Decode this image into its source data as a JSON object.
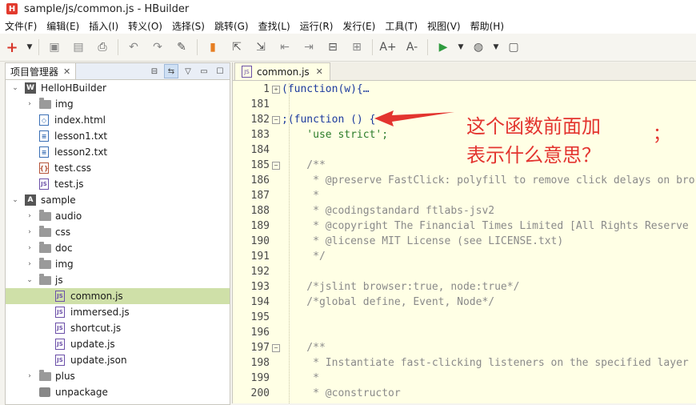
{
  "window": {
    "logo": "H",
    "title": "sample/js/common.js  -  HBuilder"
  },
  "menu": [
    "文件(F)",
    "编辑(E)",
    "插入(I)",
    "转义(O)",
    "选择(S)",
    "跳转(G)",
    "查找(L)",
    "运行(R)",
    "发行(E)",
    "工具(T)",
    "视图(V)",
    "帮助(H)"
  ],
  "toolbar": {
    "icons": [
      "new-icon",
      "save-icon",
      "save-all-icon",
      "print-icon",
      "undo-icon",
      "redo-icon",
      "format-icon",
      "bookmark-icon",
      "import-icon",
      "export-icon",
      "prev-icon",
      "next-icon",
      "comment-icon",
      "uncomment-icon",
      "font-bigger-icon",
      "font-smaller-icon",
      "run-icon",
      "browser-icon",
      "help-icon"
    ],
    "font_big": "A+",
    "font_small": "A-"
  },
  "project_panel": {
    "title": "项目管理器",
    "close": "✕",
    "tree": [
      {
        "level": 0,
        "twisty": "open",
        "icon": "project-w",
        "label": "HelloHBuilder"
      },
      {
        "level": 1,
        "twisty": "closed",
        "icon": "folder",
        "label": "img"
      },
      {
        "level": 1,
        "twisty": "",
        "icon": "html",
        "label": "index.html"
      },
      {
        "level": 1,
        "twisty": "",
        "icon": "txt",
        "label": "lesson1.txt"
      },
      {
        "level": 1,
        "twisty": "",
        "icon": "txt",
        "label": "lesson2.txt"
      },
      {
        "level": 1,
        "twisty": "",
        "icon": "css",
        "label": "test.css"
      },
      {
        "level": 1,
        "twisty": "",
        "icon": "js",
        "label": "test.js"
      },
      {
        "level": 0,
        "twisty": "open",
        "icon": "project-a",
        "label": "sample"
      },
      {
        "level": 1,
        "twisty": "closed",
        "icon": "folder",
        "label": "audio"
      },
      {
        "level": 1,
        "twisty": "closed",
        "icon": "folder",
        "label": "css"
      },
      {
        "level": 1,
        "twisty": "closed",
        "icon": "folder",
        "label": "doc"
      },
      {
        "level": 1,
        "twisty": "closed",
        "icon": "folder",
        "label": "img"
      },
      {
        "level": 1,
        "twisty": "open",
        "icon": "folder",
        "label": "js"
      },
      {
        "level": 2,
        "twisty": "",
        "icon": "js",
        "label": "common.js",
        "selected": true
      },
      {
        "level": 2,
        "twisty": "",
        "icon": "js",
        "label": "immersed.js"
      },
      {
        "level": 2,
        "twisty": "",
        "icon": "js",
        "label": "shortcut.js"
      },
      {
        "level": 2,
        "twisty": "",
        "icon": "js",
        "label": "update.js"
      },
      {
        "level": 2,
        "twisty": "",
        "icon": "json",
        "label": "update.json"
      },
      {
        "level": 1,
        "twisty": "closed",
        "icon": "folder",
        "label": "plus"
      },
      {
        "level": 1,
        "twisty": "",
        "icon": "package",
        "label": "unpackage"
      }
    ]
  },
  "editor": {
    "tab_label": "common.js",
    "tab_close": "✕",
    "lines": [
      {
        "n": "1",
        "fold": "plus",
        "text": "(function(w){…",
        "cls": "c-plain"
      },
      {
        "n": "181",
        "fold": "",
        "text": "",
        "cls": "c-plain"
      },
      {
        "n": "182",
        "fold": "minus",
        "text": ";(function () {",
        "cls": "c-kw"
      },
      {
        "n": "183",
        "fold": "",
        "text": "    'use strict';",
        "cls": "c-str"
      },
      {
        "n": "184",
        "fold": "",
        "text": "",
        "cls": "c-plain"
      },
      {
        "n": "185",
        "fold": "minus",
        "text": "    /**",
        "cls": "c-com"
      },
      {
        "n": "186",
        "fold": "",
        "text": "     * @preserve FastClick: polyfill to remove click delays on bro",
        "cls": "c-com"
      },
      {
        "n": "187",
        "fold": "",
        "text": "     *",
        "cls": "c-com"
      },
      {
        "n": "188",
        "fold": "",
        "text": "     * @codingstandard ftlabs-jsv2",
        "cls": "c-com"
      },
      {
        "n": "189",
        "fold": "",
        "text": "     * @copyright The Financial Times Limited [All Rights Reserve",
        "cls": "c-com"
      },
      {
        "n": "190",
        "fold": "",
        "text": "     * @license MIT License (see LICENSE.txt)",
        "cls": "c-com"
      },
      {
        "n": "191",
        "fold": "",
        "text": "     */",
        "cls": "c-com"
      },
      {
        "n": "192",
        "fold": "",
        "text": "",
        "cls": "c-plain"
      },
      {
        "n": "193",
        "fold": "",
        "text": "    /*jslint browser:true, node:true*/",
        "cls": "c-com"
      },
      {
        "n": "194",
        "fold": "",
        "text": "    /*global define, Event, Node*/",
        "cls": "c-com"
      },
      {
        "n": "195",
        "fold": "",
        "text": "",
        "cls": "c-plain"
      },
      {
        "n": "196",
        "fold": "",
        "text": "",
        "cls": "c-plain"
      },
      {
        "n": "197",
        "fold": "minus",
        "text": "    /**",
        "cls": "c-com"
      },
      {
        "n": "198",
        "fold": "",
        "text": "     * Instantiate fast-clicking listeners on the specified layer",
        "cls": "c-com"
      },
      {
        "n": "199",
        "fold": "",
        "text": "     *",
        "cls": "c-com"
      },
      {
        "n": "200",
        "fold": "",
        "text": "     * @constructor",
        "cls": "c-com"
      }
    ]
  },
  "annotation": {
    "line1": "这个函数前面加",
    "semicolon": "；",
    "line2": "表示什么意思？"
  },
  "colors": {
    "annotation": "#e3342f",
    "selection": "#cfe0a8",
    "editor_bg": "#ffffe5"
  }
}
